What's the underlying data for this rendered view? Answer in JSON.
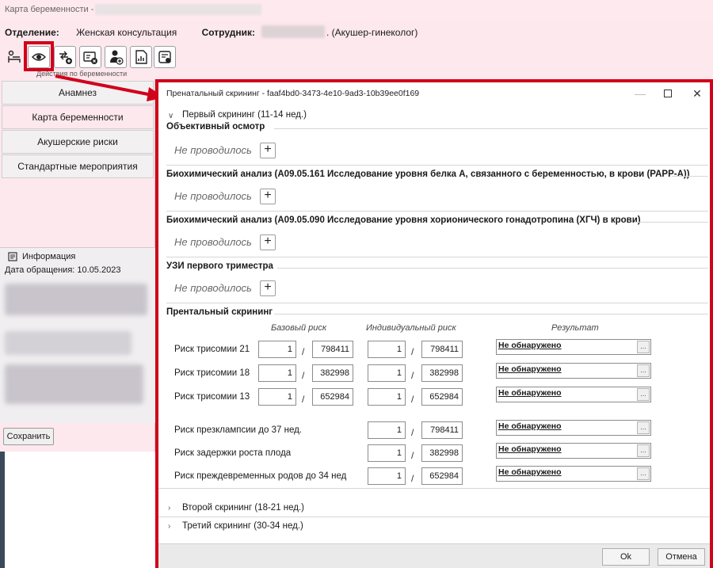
{
  "window": {
    "title": "Карта беременности -",
    "department_label": "Отделение:",
    "department_value": "Женская консультация",
    "employee_label": "Сотрудник:",
    "employee_role": ". (Акушер-гинеколог)",
    "toolbar_caption": "Действия по беременности"
  },
  "sidebar": {
    "items": [
      {
        "label": "Анамнез"
      },
      {
        "label": "Карта беременности"
      },
      {
        "label": "Акушерские риски"
      },
      {
        "label": "Стандартные мероприятия"
      }
    ],
    "info_title": "Информация",
    "info_date": "Дата обращения: 10.05.2023",
    "save_label": "Сохранить"
  },
  "dialog": {
    "title": "Пренатальный скрининг - faaf4bd0-3473-4e10-9ad3-10b39ee0f169",
    "first_section": "Первый скрининг (11-14 нед.)",
    "groups": [
      {
        "title": "Объективный осмотр",
        "status": "Не проводилось"
      },
      {
        "title": "Биохимический анализ (A09.05.161 Исследование уровня белка А, связанного с беременностью, в крови (PAPP-A))",
        "status": "Не проводилось"
      },
      {
        "title": "Биохимический анализ (A09.05.090 Исследование уровня хорионического гонадотропина (ХГЧ) в крови)",
        "status": "Не проводилось"
      },
      {
        "title": "УЗИ первого триместра",
        "status": "Не проводилось"
      }
    ],
    "screening": {
      "title": "Прентальный скрининг",
      "col_base": "Базовый риск",
      "col_individual": "Индивидуальный риск",
      "col_result": "Результат",
      "rows": [
        {
          "label": "Риск трисомии 21",
          "base_num": "1",
          "base_den": "798411",
          "ind_num": "1",
          "ind_den": "798411",
          "result": "Не обнаружено"
        },
        {
          "label": "Риск трисомии 18",
          "base_num": "1",
          "base_den": "382998",
          "ind_num": "1",
          "ind_den": "382998",
          "result": "Не обнаружено"
        },
        {
          "label": "Риск трисомии 13",
          "base_num": "1",
          "base_den": "652984",
          "ind_num": "1",
          "ind_den": "652984",
          "result": "Не обнаружено"
        },
        {
          "label": "Риск презклампсии до 37 нед.",
          "ind_num": "1",
          "ind_den": "798411",
          "result": "Не обнаружено"
        },
        {
          "label": "Риск задержки роста плода",
          "ind_num": "1",
          "ind_den": "382998",
          "result": "Не обнаружено"
        },
        {
          "label": "Риск преждевременных родов до 34 нед",
          "ind_num": "1",
          "ind_den": "652984",
          "result": "Не обнаружено"
        }
      ],
      "ellipsis": "..."
    },
    "second_section": "Второй скрининг (18-21 нед.)",
    "third_section": "Третий скрининг (30-34 нед.)",
    "ok_label": "Ok",
    "cancel_label": "Отмена"
  },
  "colors": {
    "highlight": "#d0021b",
    "pink_background": "#fde8ee"
  }
}
